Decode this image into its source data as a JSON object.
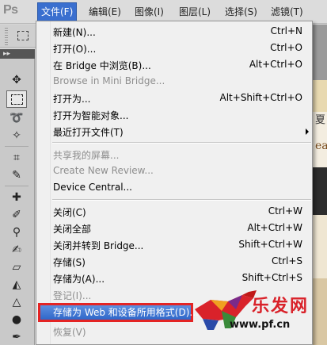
{
  "menubar": {
    "logo": "Ps",
    "items": [
      {
        "label": "文件(F)"
      },
      {
        "label": "编辑(E)"
      },
      {
        "label": "图像(I)"
      },
      {
        "label": "图层(L)"
      },
      {
        "label": "选择(S)"
      },
      {
        "label": "滤镜(T)"
      }
    ]
  },
  "toolbox": {
    "header": "▸▸"
  },
  "file_menu": {
    "items": [
      {
        "label": "新建(N)...",
        "shortcut": "Ctrl+N"
      },
      {
        "label": "打开(O)...",
        "shortcut": "Ctrl+O"
      },
      {
        "label": "在 Bridge 中浏览(B)...",
        "shortcut": "Alt+Ctrl+O"
      },
      {
        "label": "Browse in Mini Bridge...",
        "shortcut": ""
      },
      {
        "label": "打开为...",
        "shortcut": "Alt+Shift+Ctrl+O"
      },
      {
        "label": "打开为智能对象...",
        "shortcut": ""
      },
      {
        "label": "最近打开文件(T)",
        "shortcut": ""
      },
      {
        "label": "共享我的屏幕...",
        "shortcut": ""
      },
      {
        "label": "Create New Review...",
        "shortcut": ""
      },
      {
        "label": "Device Central...",
        "shortcut": ""
      },
      {
        "label": "关闭(C)",
        "shortcut": "Ctrl+W"
      },
      {
        "label": "关闭全部",
        "shortcut": "Alt+Ctrl+W"
      },
      {
        "label": "关闭并转到 Bridge...",
        "shortcut": "Shift+Ctrl+W"
      },
      {
        "label": "存储(S)",
        "shortcut": "Ctrl+S"
      },
      {
        "label": "存储为(A)...",
        "shortcut": "Shift+Ctrl+S"
      },
      {
        "label": "登记(I)...",
        "shortcut": ""
      },
      {
        "label": "存储为 Web 和设备所用格式(D)...",
        "shortcut": ""
      },
      {
        "label": "恢复(V)",
        "shortcut": ""
      }
    ]
  },
  "background": {
    "strip_text_1": "夏",
    "strip_text_2": "ea"
  },
  "watermark": {
    "text": "乐发网",
    "url": "www.pf.cn"
  },
  "colors": {
    "menu_highlight": "#3a6fcf",
    "highlight_border": "#e42424",
    "watermark_red": "#d9222a"
  }
}
